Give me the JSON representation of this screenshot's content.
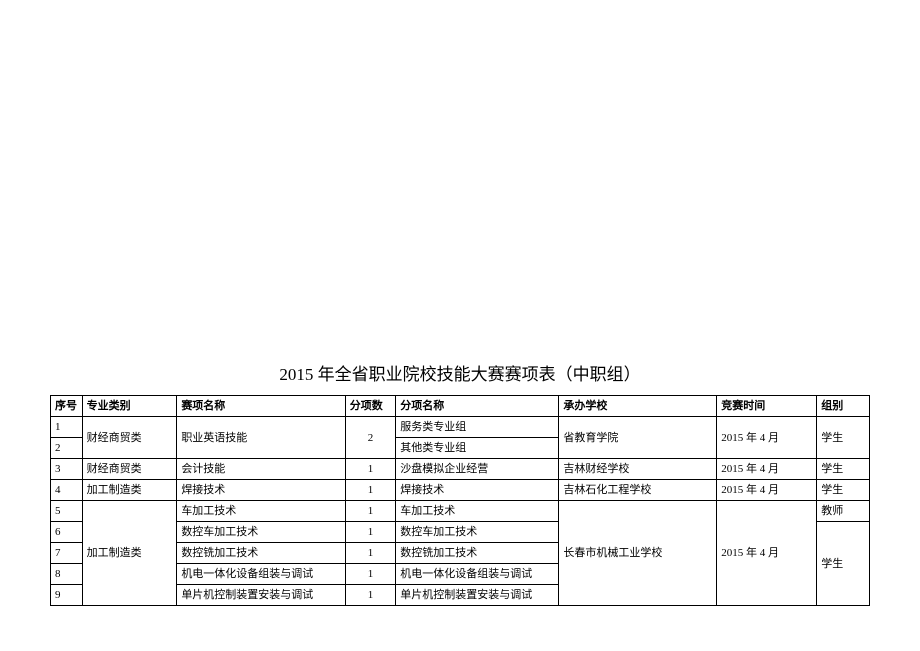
{
  "title": "2015 年全省职业院校技能大赛赛项表（中职组）",
  "headers": {
    "seq": "序号",
    "category": "专业类别",
    "name": "赛项名称",
    "count": "分项数",
    "subname": "分项名称",
    "school": "承办学校",
    "time": "竞赛时间",
    "group": "组别"
  },
  "rows": {
    "r1": {
      "seq": "1",
      "category": "财经商贸类",
      "name": "职业英语技能",
      "count": "2",
      "subname": "服务类专业组",
      "school": "省教育学院",
      "time": "2015 年 4 月",
      "group": "学生"
    },
    "r2": {
      "seq": "2",
      "subname": "其他类专业组"
    },
    "r3": {
      "seq": "3",
      "category": "财经商贸类",
      "name": "会计技能",
      "count": "1",
      "subname": "沙盘模拟企业经营",
      "school": "吉林财经学校",
      "time": "2015 年 4 月",
      "group": "学生"
    },
    "r4": {
      "seq": "4",
      "category": "加工制造类",
      "name": "焊接技术",
      "count": "1",
      "subname": "焊接技术",
      "school": "吉林石化工程学校",
      "time": "2015 年 4 月",
      "group": "学生"
    },
    "r5": {
      "seq": "5",
      "category": "加工制造类",
      "name": "车加工技术",
      "count": "1",
      "subname": "车加工技术",
      "school": "长春市机械工业学校",
      "time": "2015 年 4 月",
      "group_t": "教师",
      "group_s": "学生"
    },
    "r6": {
      "seq": "6",
      "name": "数控车加工技术",
      "count": "1",
      "subname": "数控车加工技术"
    },
    "r7": {
      "seq": "7",
      "name": "数控铣加工技术",
      "count": "1",
      "subname": "数控铣加工技术"
    },
    "r8": {
      "seq": "8",
      "name": "机电一体化设备组装与调试",
      "count": "1",
      "subname": "机电一体化设备组装与调试"
    },
    "r9": {
      "seq": "9",
      "name": "单片机控制装置安装与调试",
      "count": "1",
      "subname": "单片机控制装置安装与调试"
    }
  }
}
